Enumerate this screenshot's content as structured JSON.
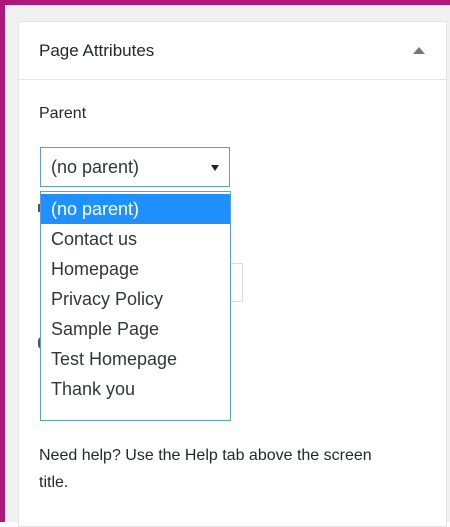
{
  "panel": {
    "title": "Page Attributes",
    "collapse_icon": "triangle-up-icon"
  },
  "parent": {
    "label": "Parent",
    "selected": "(no parent)",
    "options": [
      "(no parent)",
      "Contact us",
      "Homepage",
      "Privacy Policy",
      "Sample Page",
      "Test Homepage",
      "Thank you"
    ]
  },
  "help": {
    "text": "Need help? Use the Help tab above the screen title."
  },
  "colors": {
    "frame_border": "#b0177a",
    "selected_option_bg": "#1e90ff",
    "focus_border": "#5b9dd9"
  }
}
